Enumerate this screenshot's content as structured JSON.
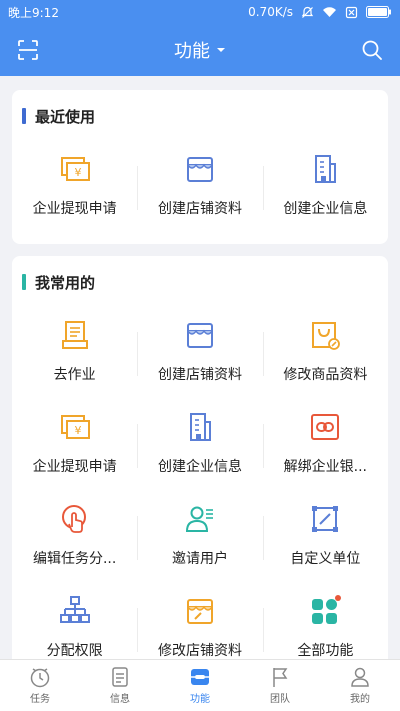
{
  "status_bar": {
    "time": "晚上9:12",
    "speed": "0.70K/s"
  },
  "header": {
    "title": "功能"
  },
  "recent": {
    "title": "最近使用",
    "accent": "#3f6bd1",
    "items": [
      {
        "label": "企业提现申请",
        "icon": "withdraw-icon"
      },
      {
        "label": "创建店铺资料",
        "icon": "store-icon"
      },
      {
        "label": "创建企业信息",
        "icon": "building-icon"
      }
    ]
  },
  "frequent": {
    "title": "我常用的",
    "accent": "#2ab5a4",
    "items": [
      {
        "label": "去作业",
        "icon": "task-doc-icon"
      },
      {
        "label": "创建店铺资料",
        "icon": "store-icon"
      },
      {
        "label": "修改商品资料",
        "icon": "product-edit-icon"
      },
      {
        "label": "企业提现申请",
        "icon": "withdraw-icon"
      },
      {
        "label": "创建企业信息",
        "icon": "building-icon"
      },
      {
        "label": "解绑企业银...",
        "icon": "unbind-bank-icon"
      },
      {
        "label": "编辑任务分...",
        "icon": "touch-hand-icon"
      },
      {
        "label": "邀请用户",
        "icon": "invite-user-icon"
      },
      {
        "label": "自定义单位",
        "icon": "custom-unit-icon"
      },
      {
        "label": "分配权限",
        "icon": "org-chart-icon"
      },
      {
        "label": "修改店铺资料",
        "icon": "store-edit-icon"
      },
      {
        "label": "全部功能",
        "icon": "all-apps-icon"
      }
    ]
  },
  "tabs": [
    {
      "label": "任务",
      "icon": "clock-icon",
      "active": false
    },
    {
      "label": "信息",
      "icon": "document-icon",
      "active": false
    },
    {
      "label": "功能",
      "icon": "function-icon",
      "active": true
    },
    {
      "label": "团队",
      "icon": "flag-icon",
      "active": false
    },
    {
      "label": "我的",
      "icon": "person-icon",
      "active": false
    }
  ],
  "colors": {
    "primary": "#4a8ff0",
    "orange": "#f0a52a",
    "blue_icon": "#5b7fd6",
    "teal": "#2ab5a4",
    "red": "#e8583a"
  }
}
